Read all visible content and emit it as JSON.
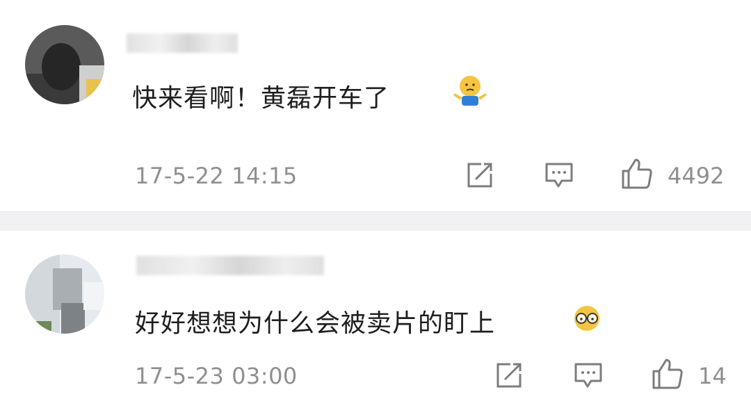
{
  "comments": [
    {
      "content": "快来看啊！黄磊开车了",
      "emoji_icon": "shrug-emoji-icon",
      "timestamp": "17-5-22 14:15",
      "like_count": "4492"
    },
    {
      "content": "好好想想为什么会被卖片的盯上",
      "emoji_icon": "glasses-face-emoji-icon",
      "timestamp": "17-5-23 03:00",
      "like_count": "14"
    }
  ],
  "icons": {
    "share": "share-icon",
    "comment": "comment-icon",
    "like": "thumbs-up-icon"
  },
  "colors": {
    "text": "#1e1e1e",
    "meta": "#8f8f8f",
    "divider": "#f1f1f3"
  }
}
